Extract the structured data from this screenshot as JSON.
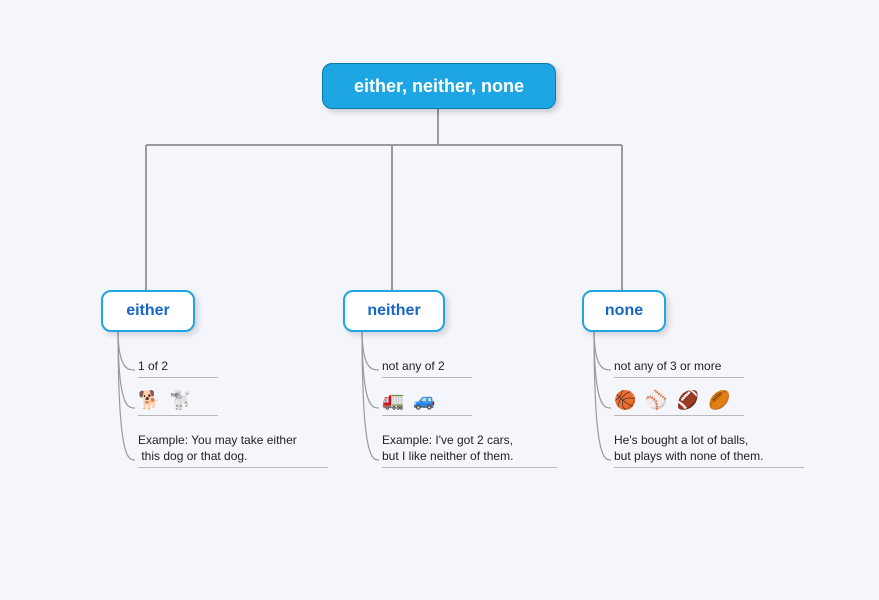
{
  "root": {
    "title": "either, neither, none"
  },
  "branches": {
    "either": {
      "label": "either",
      "definition": "1 of 2",
      "icons": "🐕 🐩",
      "example": "Example: You may take either\n this dog or that dog."
    },
    "neither": {
      "label": "neither",
      "definition": "not any of 2",
      "icons": "🚛 🚙",
      "example": "Example: I've got 2 cars,\nbut I like neither of them."
    },
    "none": {
      "label": "none",
      "definition": "not any of 3 or more",
      "icons": "🏀 ⚾ 🏈 🏉",
      "example": "He's bought a lot of balls,\nbut plays with none of them."
    }
  }
}
